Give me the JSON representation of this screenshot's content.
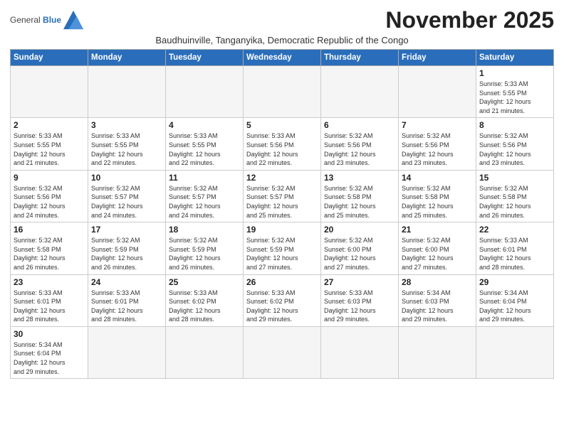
{
  "logo": {
    "line1": "General",
    "line2": "Blue"
  },
  "title": "November 2025",
  "subtitle": "Baudhuinville, Tanganyika, Democratic Republic of the Congo",
  "weekdays": [
    "Sunday",
    "Monday",
    "Tuesday",
    "Wednesday",
    "Thursday",
    "Friday",
    "Saturday"
  ],
  "weeks": [
    [
      {
        "day": "",
        "info": ""
      },
      {
        "day": "",
        "info": ""
      },
      {
        "day": "",
        "info": ""
      },
      {
        "day": "",
        "info": ""
      },
      {
        "day": "",
        "info": ""
      },
      {
        "day": "",
        "info": ""
      },
      {
        "day": "1",
        "info": "Sunrise: 5:33 AM\nSunset: 5:55 PM\nDaylight: 12 hours\nand 21 minutes."
      }
    ],
    [
      {
        "day": "2",
        "info": "Sunrise: 5:33 AM\nSunset: 5:55 PM\nDaylight: 12 hours\nand 21 minutes."
      },
      {
        "day": "3",
        "info": "Sunrise: 5:33 AM\nSunset: 5:55 PM\nDaylight: 12 hours\nand 22 minutes."
      },
      {
        "day": "4",
        "info": "Sunrise: 5:33 AM\nSunset: 5:55 PM\nDaylight: 12 hours\nand 22 minutes."
      },
      {
        "day": "5",
        "info": "Sunrise: 5:33 AM\nSunset: 5:56 PM\nDaylight: 12 hours\nand 22 minutes."
      },
      {
        "day": "6",
        "info": "Sunrise: 5:32 AM\nSunset: 5:56 PM\nDaylight: 12 hours\nand 23 minutes."
      },
      {
        "day": "7",
        "info": "Sunrise: 5:32 AM\nSunset: 5:56 PM\nDaylight: 12 hours\nand 23 minutes."
      },
      {
        "day": "8",
        "info": "Sunrise: 5:32 AM\nSunset: 5:56 PM\nDaylight: 12 hours\nand 23 minutes."
      }
    ],
    [
      {
        "day": "9",
        "info": "Sunrise: 5:32 AM\nSunset: 5:56 PM\nDaylight: 12 hours\nand 24 minutes."
      },
      {
        "day": "10",
        "info": "Sunrise: 5:32 AM\nSunset: 5:57 PM\nDaylight: 12 hours\nand 24 minutes."
      },
      {
        "day": "11",
        "info": "Sunrise: 5:32 AM\nSunset: 5:57 PM\nDaylight: 12 hours\nand 24 minutes."
      },
      {
        "day": "12",
        "info": "Sunrise: 5:32 AM\nSunset: 5:57 PM\nDaylight: 12 hours\nand 25 minutes."
      },
      {
        "day": "13",
        "info": "Sunrise: 5:32 AM\nSunset: 5:58 PM\nDaylight: 12 hours\nand 25 minutes."
      },
      {
        "day": "14",
        "info": "Sunrise: 5:32 AM\nSunset: 5:58 PM\nDaylight: 12 hours\nand 25 minutes."
      },
      {
        "day": "15",
        "info": "Sunrise: 5:32 AM\nSunset: 5:58 PM\nDaylight: 12 hours\nand 26 minutes."
      }
    ],
    [
      {
        "day": "16",
        "info": "Sunrise: 5:32 AM\nSunset: 5:58 PM\nDaylight: 12 hours\nand 26 minutes."
      },
      {
        "day": "17",
        "info": "Sunrise: 5:32 AM\nSunset: 5:59 PM\nDaylight: 12 hours\nand 26 minutes."
      },
      {
        "day": "18",
        "info": "Sunrise: 5:32 AM\nSunset: 5:59 PM\nDaylight: 12 hours\nand 26 minutes."
      },
      {
        "day": "19",
        "info": "Sunrise: 5:32 AM\nSunset: 5:59 PM\nDaylight: 12 hours\nand 27 minutes."
      },
      {
        "day": "20",
        "info": "Sunrise: 5:32 AM\nSunset: 6:00 PM\nDaylight: 12 hours\nand 27 minutes."
      },
      {
        "day": "21",
        "info": "Sunrise: 5:32 AM\nSunset: 6:00 PM\nDaylight: 12 hours\nand 27 minutes."
      },
      {
        "day": "22",
        "info": "Sunrise: 5:33 AM\nSunset: 6:01 PM\nDaylight: 12 hours\nand 28 minutes."
      }
    ],
    [
      {
        "day": "23",
        "info": "Sunrise: 5:33 AM\nSunset: 6:01 PM\nDaylight: 12 hours\nand 28 minutes."
      },
      {
        "day": "24",
        "info": "Sunrise: 5:33 AM\nSunset: 6:01 PM\nDaylight: 12 hours\nand 28 minutes."
      },
      {
        "day": "25",
        "info": "Sunrise: 5:33 AM\nSunset: 6:02 PM\nDaylight: 12 hours\nand 28 minutes."
      },
      {
        "day": "26",
        "info": "Sunrise: 5:33 AM\nSunset: 6:02 PM\nDaylight: 12 hours\nand 29 minutes."
      },
      {
        "day": "27",
        "info": "Sunrise: 5:33 AM\nSunset: 6:03 PM\nDaylight: 12 hours\nand 29 minutes."
      },
      {
        "day": "28",
        "info": "Sunrise: 5:34 AM\nSunset: 6:03 PM\nDaylight: 12 hours\nand 29 minutes."
      },
      {
        "day": "29",
        "info": "Sunrise: 5:34 AM\nSunset: 6:04 PM\nDaylight: 12 hours\nand 29 minutes."
      }
    ],
    [
      {
        "day": "30",
        "info": "Sunrise: 5:34 AM\nSunset: 6:04 PM\nDaylight: 12 hours\nand 29 minutes."
      },
      {
        "day": "",
        "info": ""
      },
      {
        "day": "",
        "info": ""
      },
      {
        "day": "",
        "info": ""
      },
      {
        "day": "",
        "info": ""
      },
      {
        "day": "",
        "info": ""
      },
      {
        "day": "",
        "info": ""
      }
    ]
  ]
}
